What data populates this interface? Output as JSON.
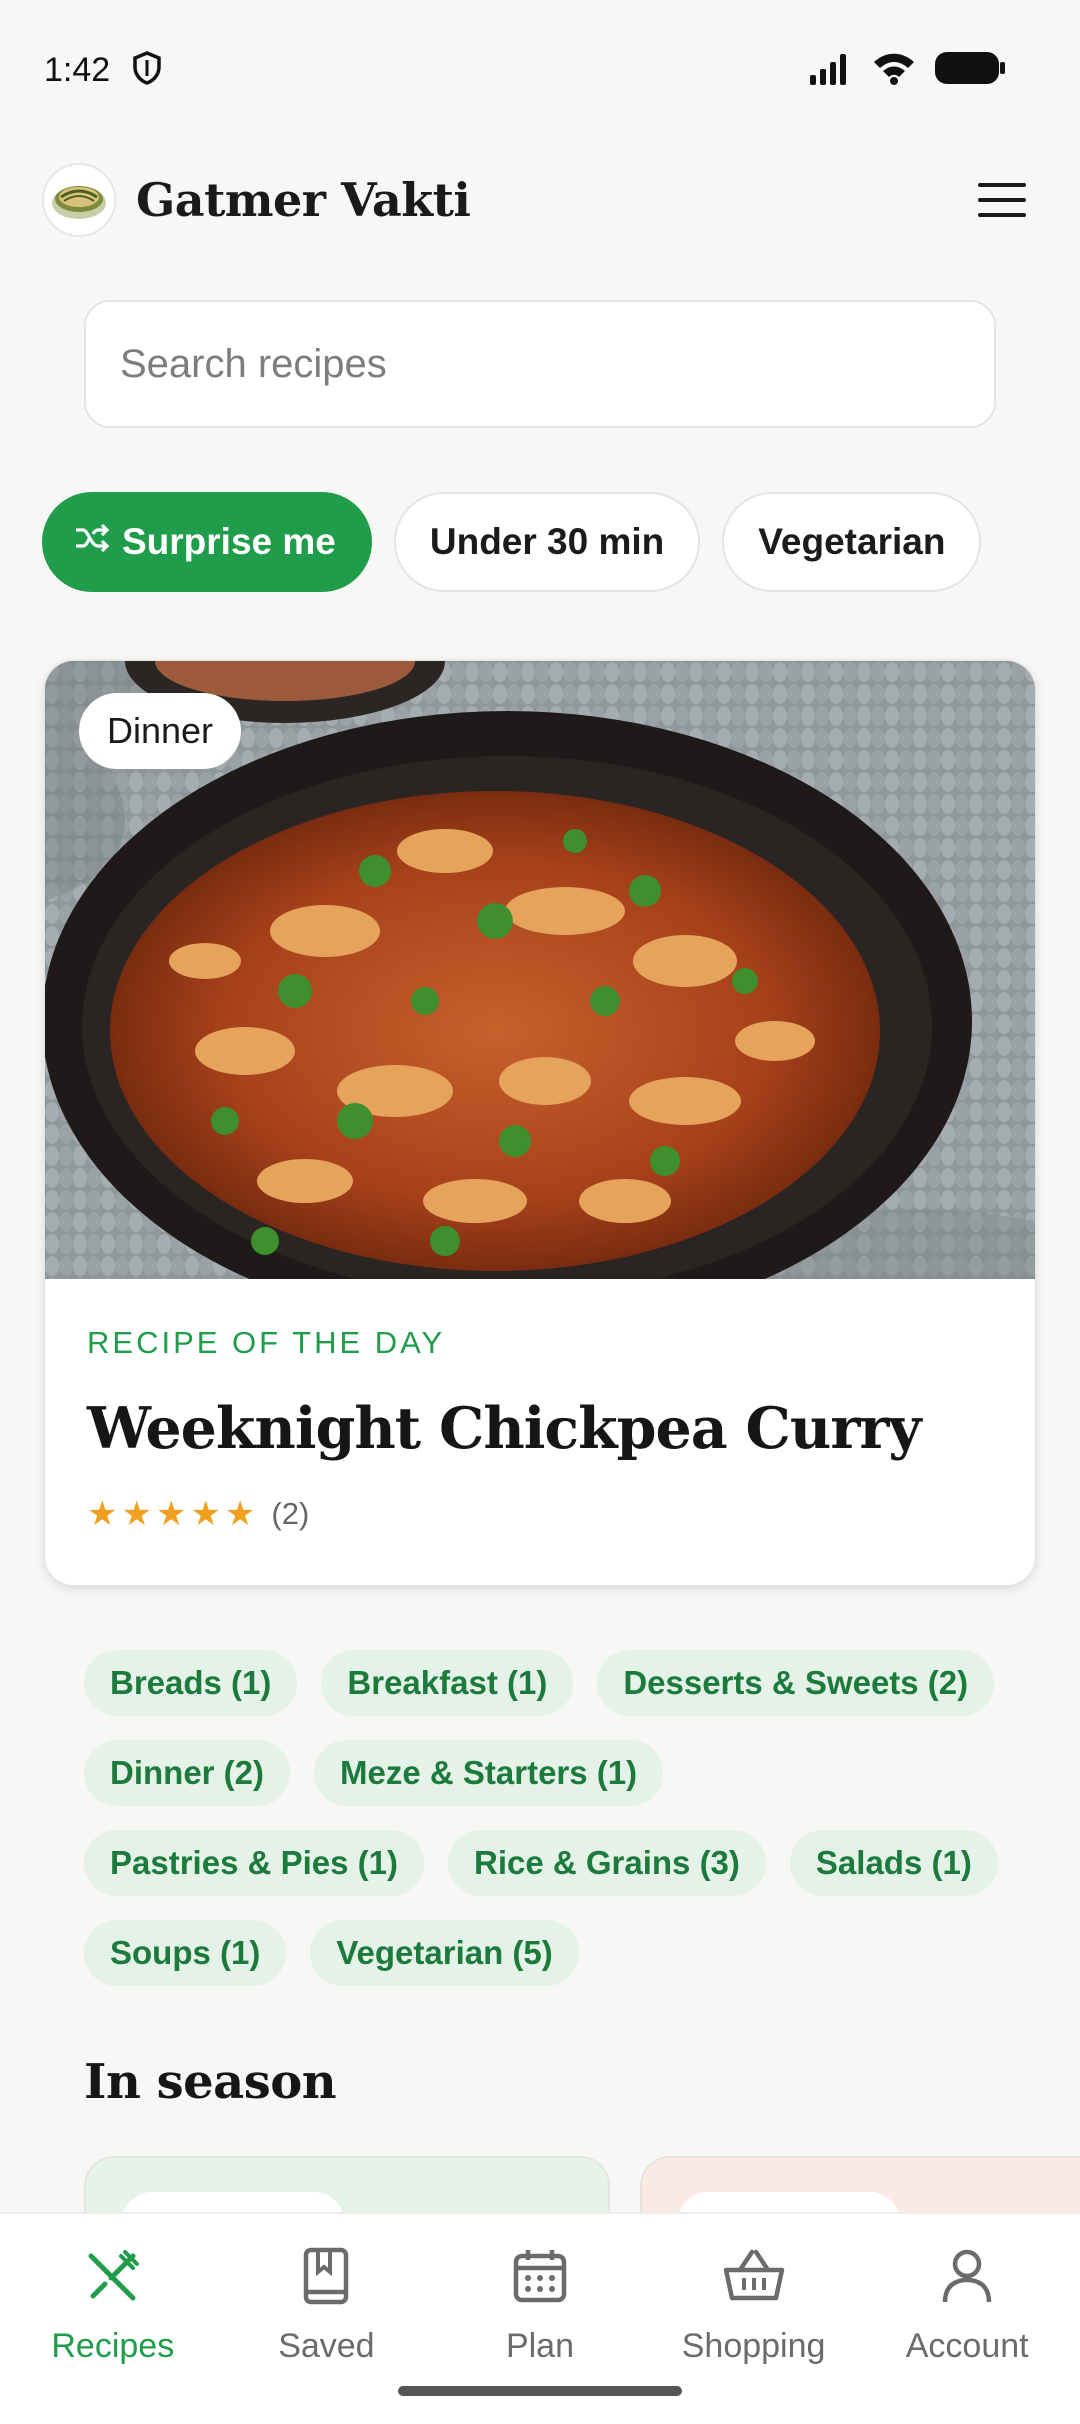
{
  "status": {
    "time": "1:42"
  },
  "app": {
    "name": "Gatmer Vakti"
  },
  "search": {
    "placeholder": "Search recipes"
  },
  "quick_filters": [
    {
      "label": "Surprise me",
      "icon": "shuffle-icon",
      "active": true
    },
    {
      "label": "Under 30 min"
    },
    {
      "label": "Vegetarian"
    }
  ],
  "feature": {
    "badge": "Dinner",
    "eyebrow": "RECIPE OF THE DAY",
    "title": "Weeknight Chickpea Curry",
    "stars": "★★★★★",
    "rating_count": "(2)",
    "rating": 5
  },
  "categories": [
    "Breads (1)",
    "Breakfast (1)",
    "Desserts & Sweets (2)",
    "Dinner (2)",
    "Meze & Starters (1)",
    "Pastries & Pies (1)",
    "Rice & Grains (3)",
    "Salads (1)",
    "Soups (1)",
    "Vegetarian (5)"
  ],
  "sections": {
    "in_season": "In season"
  },
  "nav": [
    {
      "label": "Recipes",
      "icon": "utensils-icon",
      "active": true
    },
    {
      "label": "Saved",
      "icon": "book-icon"
    },
    {
      "label": "Plan",
      "icon": "calendar-icon"
    },
    {
      "label": "Shopping",
      "icon": "basket-icon"
    },
    {
      "label": "Account",
      "icon": "person-icon"
    }
  ],
  "colors": {
    "accent": "#1f9d4a",
    "chip_bg": "#e4f2e8",
    "chip_text": "#1b7a3c",
    "star": "#f0a020",
    "background": "#f7f7f5"
  }
}
